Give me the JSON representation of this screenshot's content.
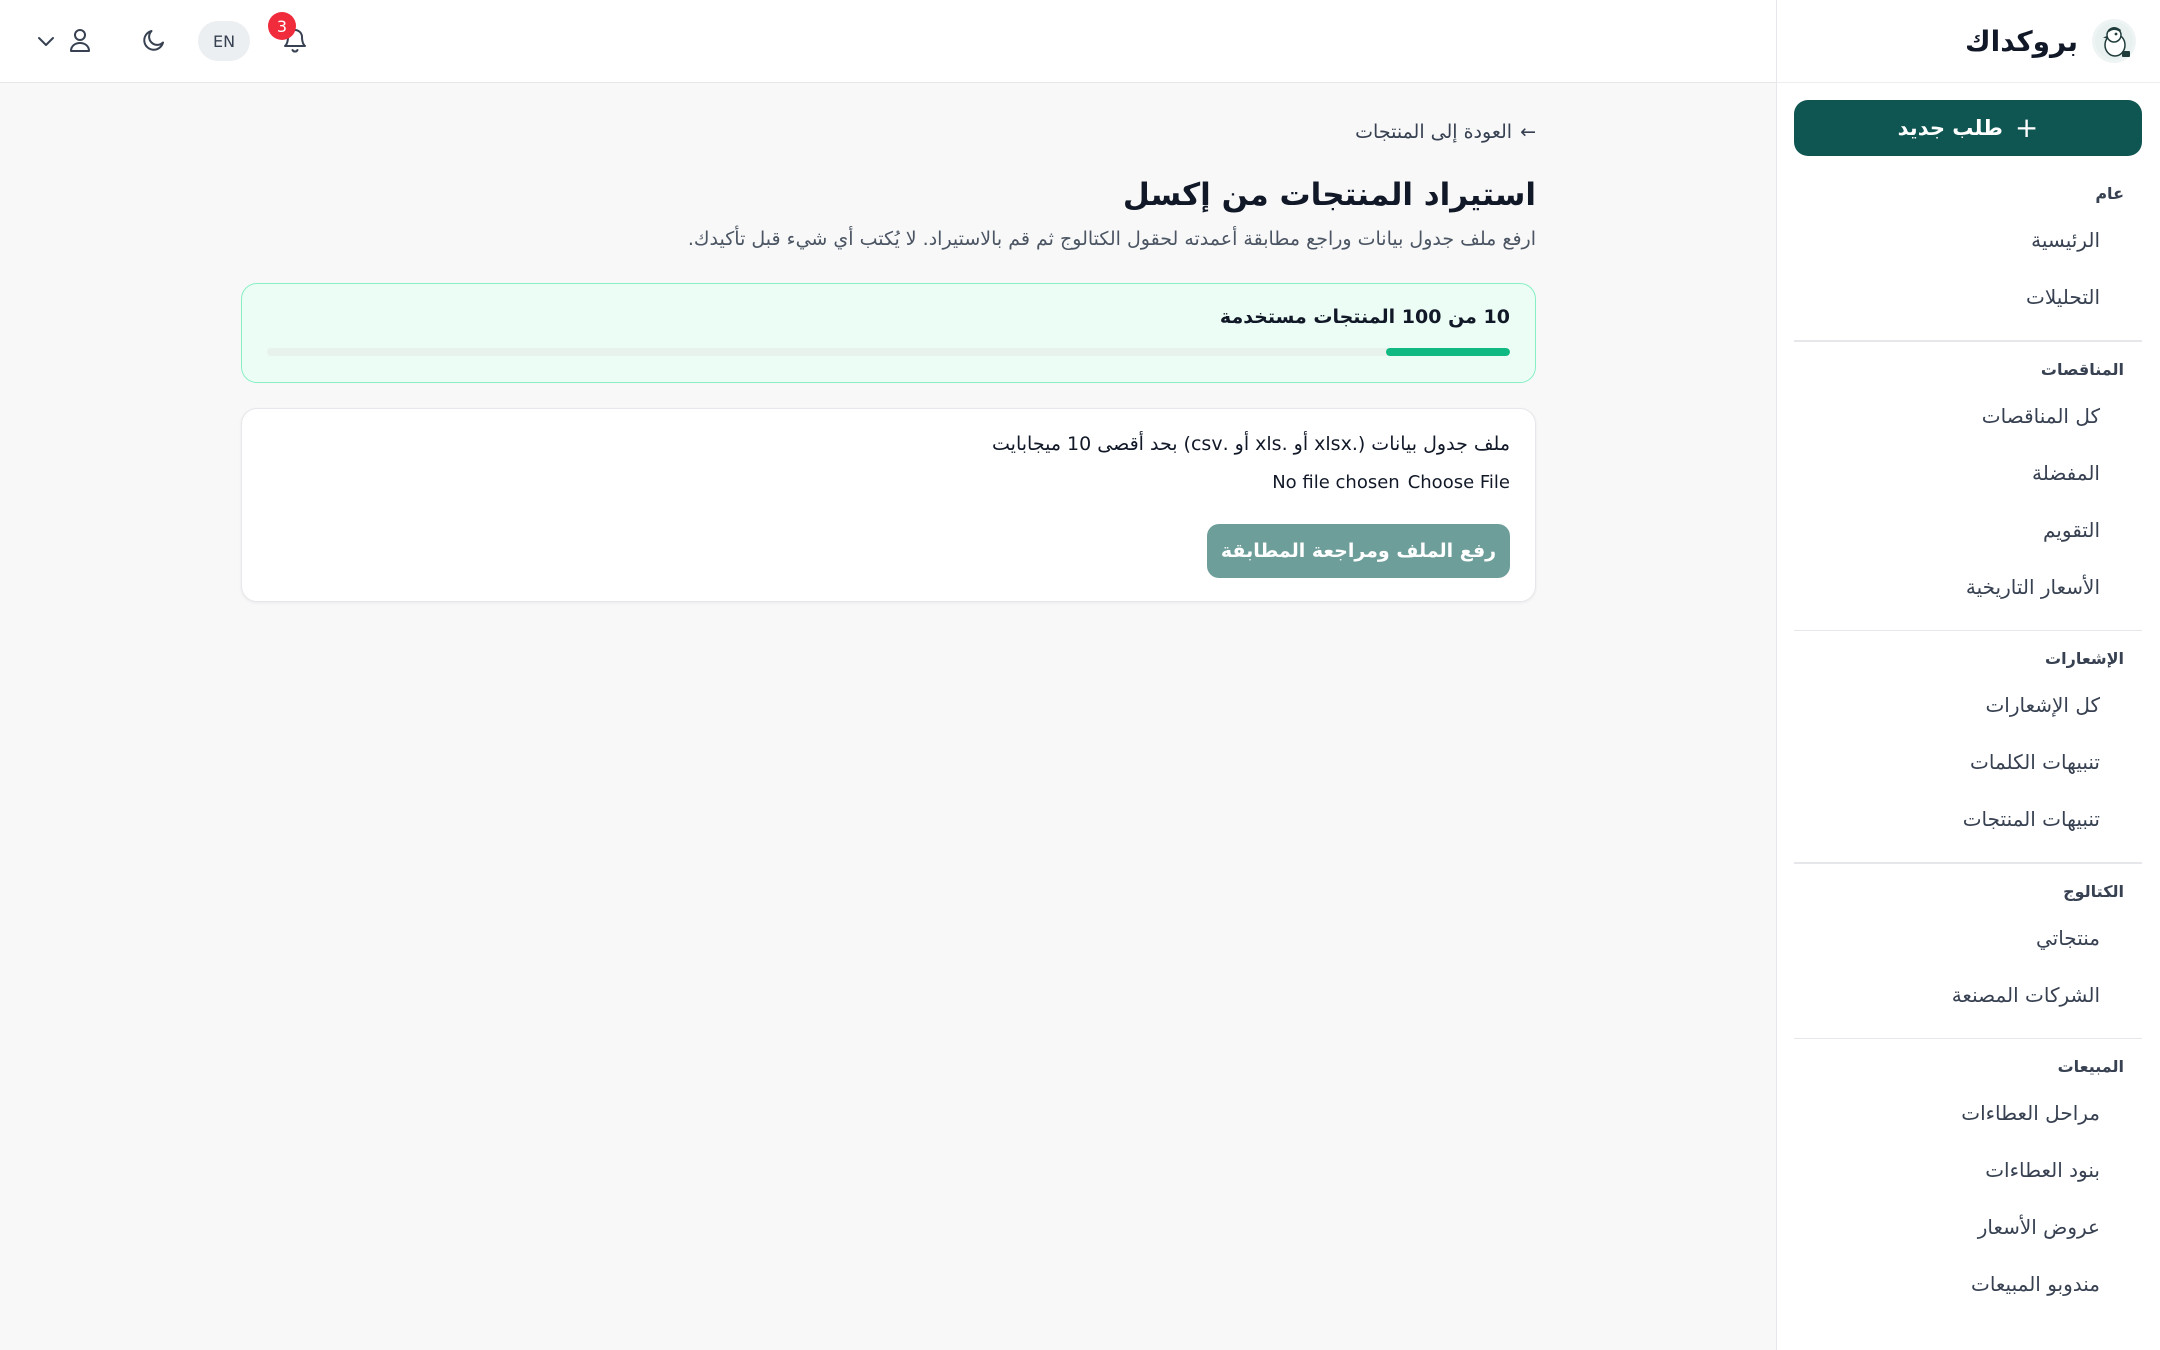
{
  "brand": {
    "name": "بروكداك",
    "logo_icon": "duck-logo-icon"
  },
  "sidebar": {
    "new_order_label": "طلب جديد",
    "sections": [
      {
        "title": "عام",
        "items": [
          "الرئيسية",
          "التحليلات"
        ]
      },
      {
        "title": "المناقصات",
        "items": [
          "كل المناقصات",
          "المفضلة",
          "التقويم",
          "الأسعار التاريخية"
        ]
      },
      {
        "title": "الإشعارات",
        "items": [
          "كل الإشعارات",
          "تنبيهات الكلمات",
          "تنبيهات المنتجات"
        ]
      },
      {
        "title": "الكتالوج",
        "items": [
          "منتجاتي",
          "الشركات المصنعة"
        ]
      },
      {
        "title": "المبيعات",
        "items": [
          "مراحل العطاءات",
          "بنود العطاءات",
          "عروض الأسعار",
          "مندوبو المبيعات"
        ]
      }
    ]
  },
  "topbar": {
    "notification_count": "3",
    "language_label": "EN"
  },
  "main": {
    "back_link": "العودة إلى المنتجات",
    "back_arrow": "←",
    "title": "استيراد المنتجات من إكسل",
    "subtitle": "ارفع ملف جدول بيانات وراجع مطابقة أعمدته لحقول الكتالوج ثم قم بالاستيراد. لا يُكتب أي شيء قبل تأكيدك.",
    "quota_text": "10 من 100 المنتجات مستخدمة",
    "quota_used": 10,
    "quota_total": 100,
    "file_label": "ملف جدول بيانات (.xlsx أو .xls أو .csv) بحد أقصى 10 ميجابايت",
    "file_button": "Choose File",
    "file_status": "No file chosen",
    "upload_button": "رفع الملف ومراجعة المطابقة"
  },
  "colors": {
    "primary": "#0f5552",
    "upload_button": "#6e9e9a",
    "quota_fill": "#10b981",
    "badge": "#ef2b3c"
  }
}
